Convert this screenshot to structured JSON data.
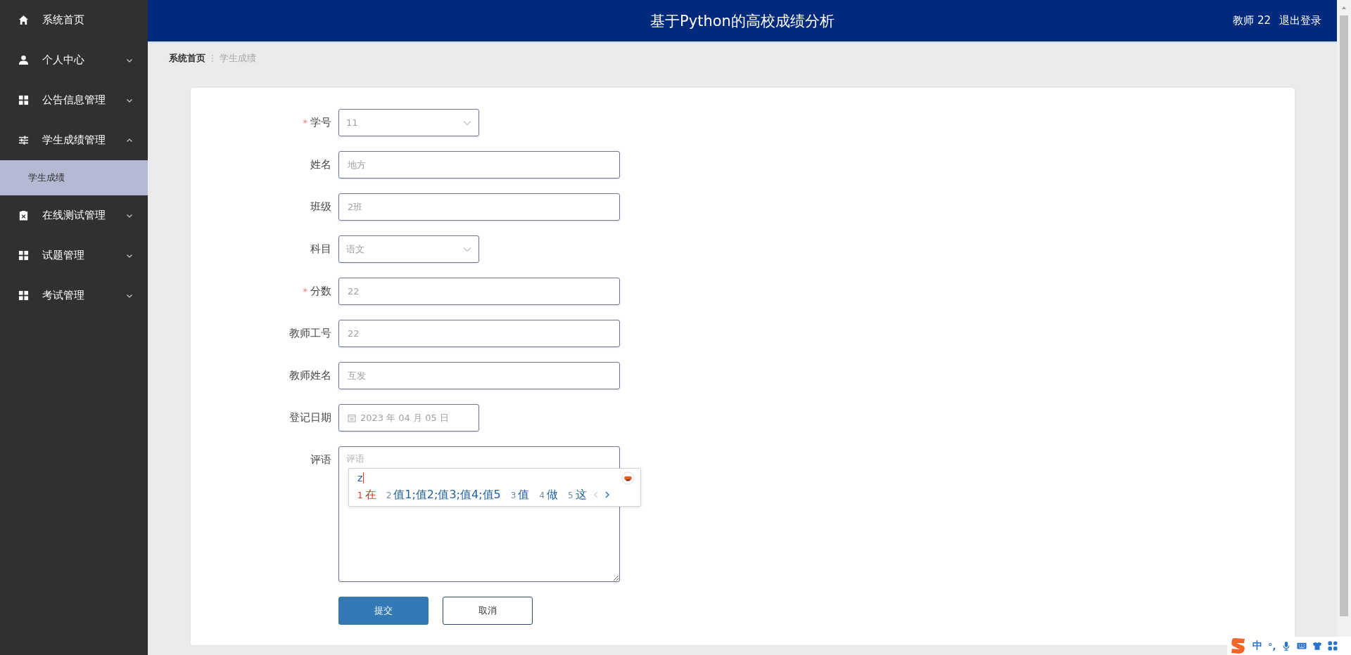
{
  "sidebar": {
    "items": [
      {
        "label": "系统首页",
        "kind": "home",
        "selected": false
      },
      {
        "label": "个人中心",
        "kind": "profile",
        "selected": false,
        "expanded": false
      },
      {
        "label": "公告信息管理",
        "kind": "module",
        "selected": false,
        "expanded": false
      },
      {
        "label": "学生成绩管理",
        "kind": "settings",
        "selected": false,
        "expanded": true,
        "children": [
          {
            "label": "学生成绩",
            "selected": true
          }
        ]
      },
      {
        "label": "在线测试管理",
        "kind": "test",
        "selected": false,
        "expanded": false
      },
      {
        "label": "试题管理",
        "kind": "module",
        "selected": false,
        "expanded": false
      },
      {
        "label": "考试管理",
        "kind": "module",
        "selected": false,
        "expanded": false
      }
    ]
  },
  "header": {
    "title": "基于Python的高校成绩分析",
    "user": "教师 22",
    "logout": "退出登录"
  },
  "breadcrumb": [
    {
      "label": "系统首页",
      "current": false
    },
    {
      "label": "学生成绩",
      "current": true
    }
  ],
  "form": {
    "fields": [
      {
        "label": "学号",
        "kind": "select",
        "value": "11",
        "required_mark": "*"
      },
      {
        "label": "姓名",
        "kind": "text",
        "value": "地方"
      },
      {
        "label": "班级",
        "kind": "text",
        "value": "2班"
      },
      {
        "label": "科目",
        "kind": "select",
        "value": "语文"
      },
      {
        "label": "分数",
        "kind": "text",
        "value": "22",
        "required_mark": "*"
      },
      {
        "label": "教师工号",
        "kind": "text",
        "value": "22"
      },
      {
        "label": "教师姓名",
        "kind": "text",
        "value": "互发"
      },
      {
        "label": "登记日期",
        "kind": "date",
        "value": "2023 年 04 月 05 日"
      },
      {
        "label": "评语",
        "kind": "textarea",
        "placeholder": "评语"
      }
    ],
    "buttons": [
      {
        "label": "提交",
        "kind": "primary"
      },
      {
        "label": "取消",
        "kind": "default"
      }
    ]
  },
  "ime": {
    "composition": "z",
    "candidates": [
      {
        "index": "1",
        "text": "在",
        "selected": true
      },
      {
        "index": "2",
        "text": "值1;值2;值3;值4;值5",
        "selected": false
      },
      {
        "index": "3",
        "text": "值",
        "selected": false
      },
      {
        "index": "4",
        "text": "做",
        "selected": false
      },
      {
        "index": "5",
        "text": "这",
        "selected": false
      }
    ]
  },
  "ime_toolbar": {
    "mode": "中",
    "punctuation": "°,"
  }
}
